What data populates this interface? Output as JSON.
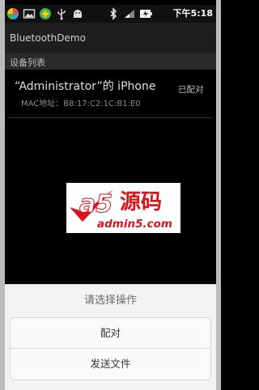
{
  "status_bar": {
    "time_prefix": "下午",
    "time": "5:18",
    "icons": [
      "app-launcher-icon",
      "gallery-icon",
      "game-icon",
      "usb-icon",
      "android-debug-icon",
      "bluetooth-icon",
      "signal-icon",
      "battery-icon"
    ]
  },
  "app": {
    "title": "BluetoothDemo"
  },
  "list": {
    "section_label": "设备列表",
    "devices": [
      {
        "name": "“Administrator”的 iPhone",
        "mac": "MAC地址：B8:17:C2:1C:B1:E0",
        "status": "已配对"
      }
    ]
  },
  "watermark": {
    "brand": "源码",
    "a5": "a5",
    "domain": "admin5.com",
    "brand_color": "#d7141a"
  },
  "dialog": {
    "title": "请选择操作",
    "actions": [
      {
        "label": "配对"
      },
      {
        "label": "发送文件"
      }
    ]
  },
  "colors": {
    "background": "#000000",
    "dialog": "#f3f3f3"
  }
}
